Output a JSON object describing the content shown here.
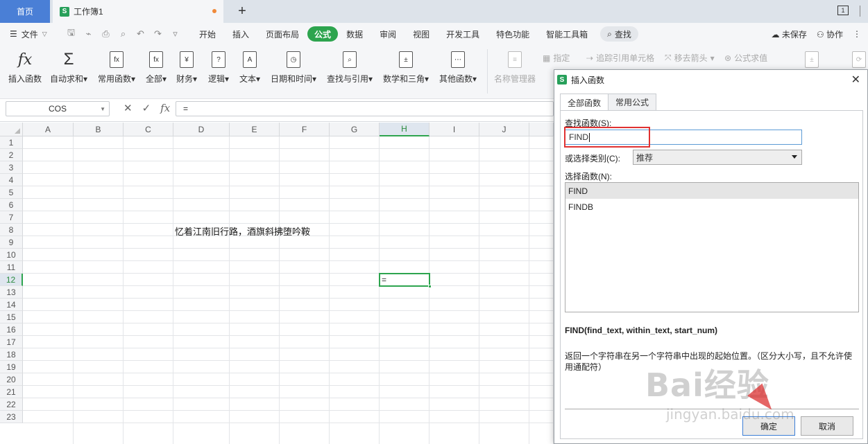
{
  "tabs": {
    "home": "首页",
    "doc": "工作簿1",
    "add": "+",
    "window_count": "1"
  },
  "menu": {
    "file": "文件",
    "items": [
      "开始",
      "插入",
      "页面布局",
      "公式",
      "数据",
      "审阅",
      "视图",
      "开发工具",
      "特色功能",
      "智能工具箱"
    ],
    "active_index": 3,
    "search": "查找",
    "unsaved": "未保存",
    "collab": "协作"
  },
  "ribbon": {
    "buttons": [
      {
        "label": "插入函数",
        "icon": "fx"
      },
      {
        "label": "自动求和",
        "icon": "Σ",
        "dropdown": true
      },
      {
        "label": "常用函数",
        "icon": "fx",
        "dropdown": true
      },
      {
        "label": "全部",
        "icon": "fx",
        "dropdown": true
      },
      {
        "label": "财务",
        "icon": "¥",
        "dropdown": true
      },
      {
        "label": "逻辑",
        "icon": "?",
        "dropdown": true
      },
      {
        "label": "文本",
        "icon": "A",
        "dropdown": true
      },
      {
        "label": "日期和时间",
        "icon": "◷",
        "dropdown": true
      },
      {
        "label": "查找与引用",
        "icon": "⌕",
        "dropdown": true
      },
      {
        "label": "数学和三角",
        "icon": "±",
        "dropdown": true
      },
      {
        "label": "其他函数",
        "icon": "⋯",
        "dropdown": true
      }
    ],
    "name_manager": "名称管理器",
    "specify": "指定",
    "trace_ref": "追踪引用单元格",
    "remove_arrow": "移去箭头",
    "eval_formula": "公式求值"
  },
  "formula_bar": {
    "name_box": "COS",
    "content": "=",
    "fx": "fx",
    "cancel": "✕",
    "confirm": "✓"
  },
  "sheet": {
    "columns": [
      "A",
      "B",
      "C",
      "D",
      "E",
      "F",
      "G",
      "H",
      "I",
      "J"
    ],
    "rows": [
      "1",
      "2",
      "3",
      "4",
      "5",
      "6",
      "7",
      "8",
      "9",
      "10",
      "11",
      "12",
      "13",
      "14",
      "15",
      "16",
      "17",
      "18",
      "19",
      "20",
      "21",
      "22",
      "23"
    ],
    "selected_column": "H",
    "selected_row": "12",
    "d8_text": "忆着江南旧行路，酒旗斜拂堕吟鞍",
    "h12_text": "="
  },
  "dialog": {
    "title": "插入函数",
    "tabs": [
      "全部函数",
      "常用公式"
    ],
    "search_label": "查找函数(S):",
    "search_value": "FIND",
    "category_label": "或选择类别(C):",
    "category_value": "推荐",
    "list_label": "选择函数(N):",
    "functions": [
      "FIND",
      "FINDB"
    ],
    "selected_function": "FIND",
    "signature": "FIND(find_text, within_text, start_num)",
    "description": "返回一个字符串在另一个字符串中出现的起始位置。（区分大小写，且不允许使用通配符）",
    "ok": "确定",
    "cancel": "取消"
  },
  "watermark": {
    "main": "Bai经验",
    "sub": "jingyan.baidu.com"
  }
}
